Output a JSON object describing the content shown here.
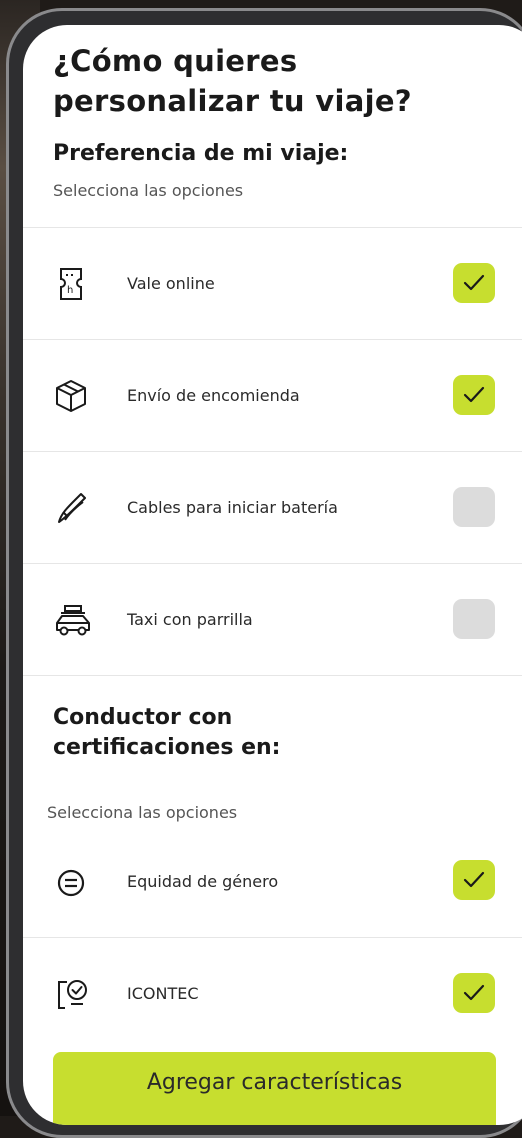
{
  "header": {
    "title": "¿Cómo quieres personalizar tu viaje?"
  },
  "preferences": {
    "title": "Preferencia de mi viaje:",
    "hint": "Selecciona las opciones",
    "items": [
      {
        "label": "Vale online",
        "checked": true,
        "icon": "voucher-icon"
      },
      {
        "label": "Envío de encomienda",
        "checked": true,
        "icon": "package-icon"
      },
      {
        "label": "Cables para iniciar batería",
        "checked": false,
        "icon": "jumper-cables-icon"
      },
      {
        "label": "Taxi con parrilla",
        "checked": false,
        "icon": "car-roof-rack-icon"
      }
    ]
  },
  "certifications": {
    "title": "Conductor con certificaciones en:",
    "hint": "Selecciona las opciones",
    "items": [
      {
        "label": "Equidad de género",
        "checked": true,
        "icon": "equality-icon"
      },
      {
        "label": "ICONTEC",
        "checked": true,
        "icon": "certificate-icon"
      }
    ]
  },
  "footer": {
    "button_label": "Agregar características"
  },
  "colors": {
    "accent": "#c7de2f",
    "unchecked": "#dcdcdc",
    "text": "#1a1a1a"
  }
}
